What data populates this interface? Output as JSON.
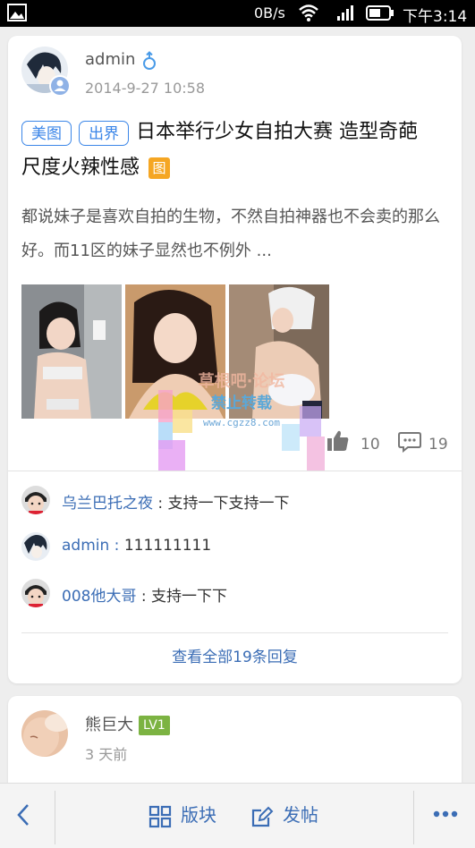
{
  "status_bar": {
    "net_speed": "0B/s",
    "time": "下午3:14",
    "icons": [
      "picture-icon",
      "wifi-icon",
      "signal-icon",
      "battery-icon"
    ]
  },
  "post": {
    "author": "admin",
    "gender_icon": "male-icon",
    "timestamp": "2014-9-27 10:58",
    "tags": [
      "美图",
      "出界"
    ],
    "title_line1": "日本举行少女自拍大赛 造型奇葩",
    "title_line2": "尺度火辣性感",
    "pic_badge": "图",
    "excerpt": "都说妹子是喜欢自拍的生物，不然自拍神器也不会卖的那么好。而11区的妹子显然也不例外 ...",
    "likes": "10",
    "comments": "19",
    "watermark_line1": "草根吧·论坛",
    "watermark_line2": "禁止转载",
    "watermark_line3": "www.cgzz8.com",
    "replies": [
      {
        "name": "乌兰巴托之夜",
        "sep": " : ",
        "text": "支持一下支持一下"
      },
      {
        "name": "admin",
        "sep": " : ",
        "text": "111111111"
      },
      {
        "name": "008他大哥",
        "sep": " : ",
        "text": "支持一下下"
      }
    ],
    "view_all": "查看全部19条回复"
  },
  "post2": {
    "author": "熊巨大",
    "level": "LV1",
    "timestamp": "3 天前"
  },
  "bottom_bar": {
    "boards_label": "版块",
    "post_label": "发帖"
  },
  "colors": {
    "accent": "#3b6db5",
    "tag_blue": "#3b86e8",
    "badge_orange": "#f5a623",
    "level_green": "#7cb342"
  }
}
